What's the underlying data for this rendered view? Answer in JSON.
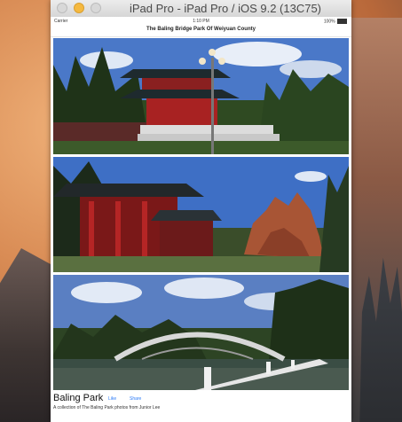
{
  "window": {
    "title": "iPad Pro - iPad Pro / iOS 9.2 (13C75)"
  },
  "status_bar": {
    "carrier": "Carrier",
    "time": "1:10 PM",
    "battery": "100%"
  },
  "page": {
    "title": "The Baling Bridge Park Of Weiyuan County"
  },
  "footer": {
    "title": "Baling Park",
    "like_label": "Like",
    "share_label": "Share",
    "description": "A collection of The Baling Park photos from Junior Lee"
  }
}
